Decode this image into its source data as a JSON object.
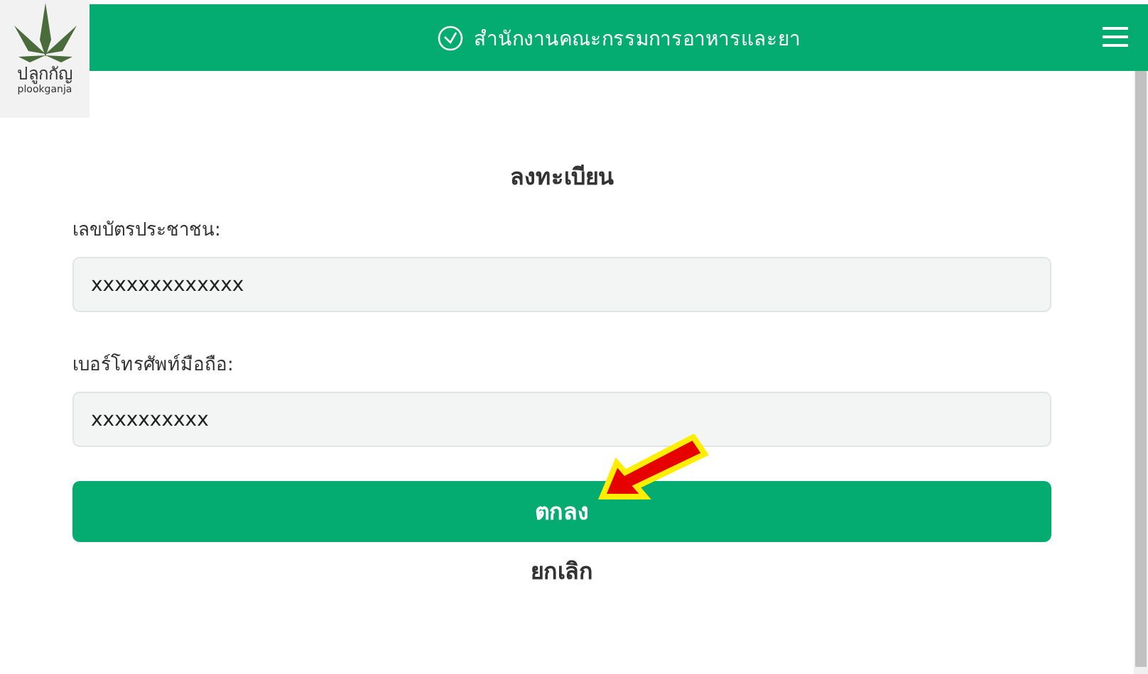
{
  "logo": {
    "thai": "ปลูกกัญ",
    "latin": "plookganja"
  },
  "header": {
    "title": "สำนักงานคณะกรรมการอาหารและยา"
  },
  "form": {
    "title": "ลงทะเบียน",
    "fields": [
      {
        "label": "เลขบัตรประชาชน:",
        "value": "xxxxxxxxxxxxx"
      },
      {
        "label": "เบอร์โทรศัพท์มือถือ:",
        "value": "xxxxxxxxxx"
      }
    ],
    "submit": "ตกลง",
    "cancel": "ยกเลิก"
  }
}
